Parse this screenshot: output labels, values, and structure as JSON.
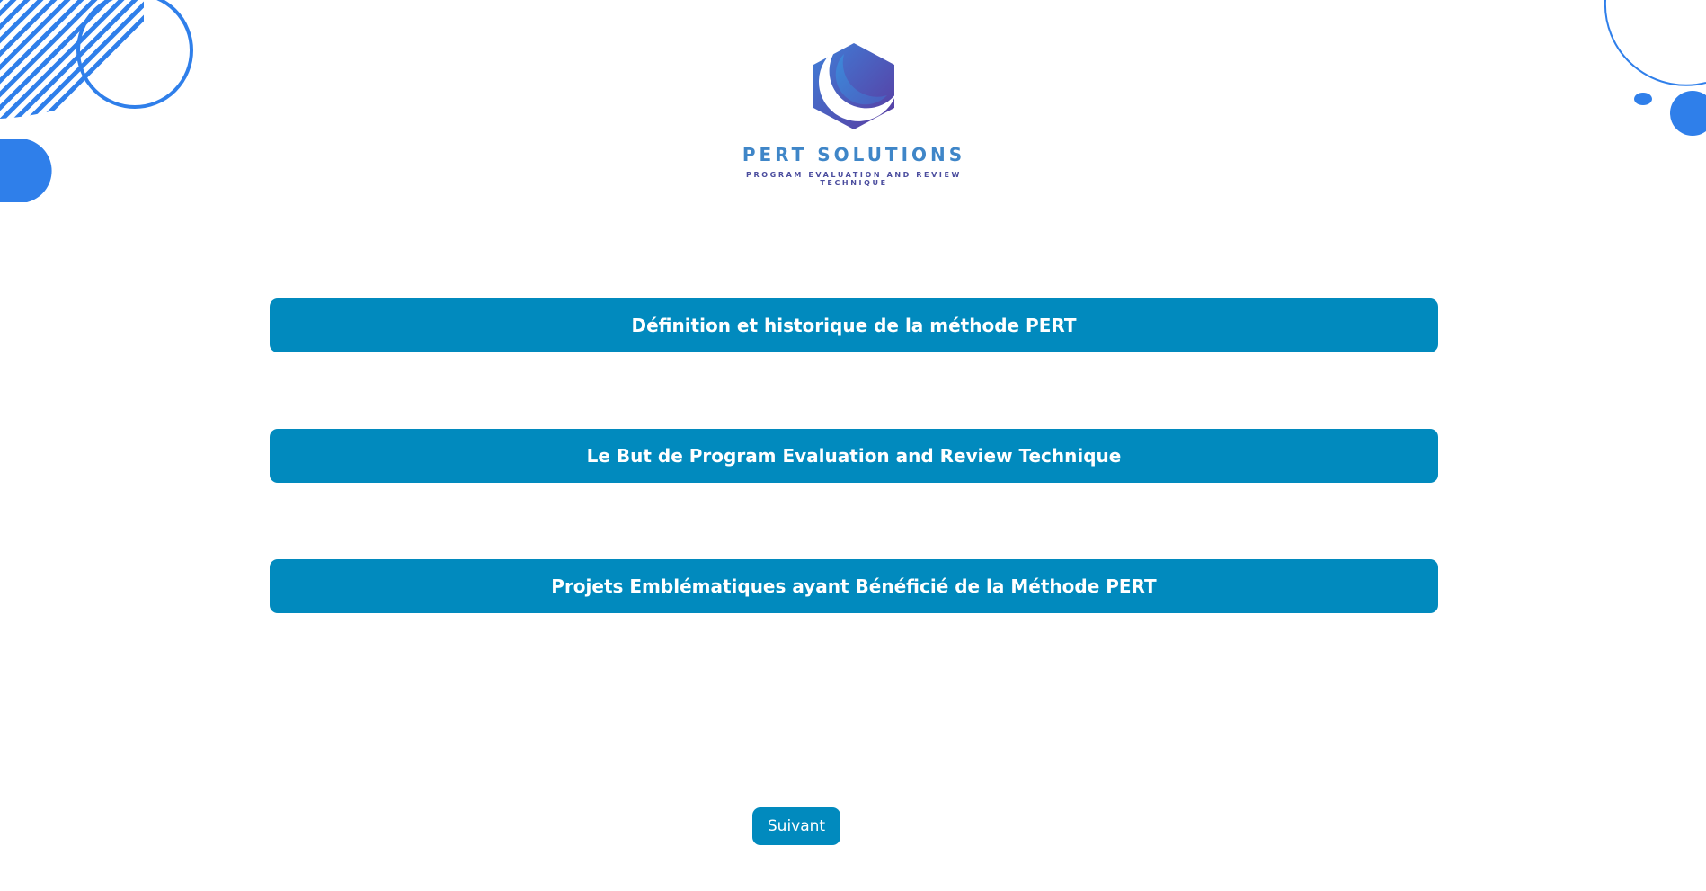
{
  "logo": {
    "title": "PERT SOLUTIONS",
    "subtitle": "PROGRAM EVALUATION AND REVIEW TECHNIQUE"
  },
  "topics": [
    {
      "label": "Définition et historique de la méthode PERT"
    },
    {
      "label": "Le But de Program Evaluation and Review Technique"
    },
    {
      "label": "Projets Emblématiques ayant Bénéficié de la Méthode PERT"
    }
  ],
  "navigation": {
    "next_label": "Suivant"
  },
  "colors": {
    "button_bg": "#018abe",
    "button_text": "#ffffff",
    "decor_blue": "#2f7fea",
    "logo_blue": "#3f86c8",
    "logo_purple": "#4b4d9e"
  }
}
